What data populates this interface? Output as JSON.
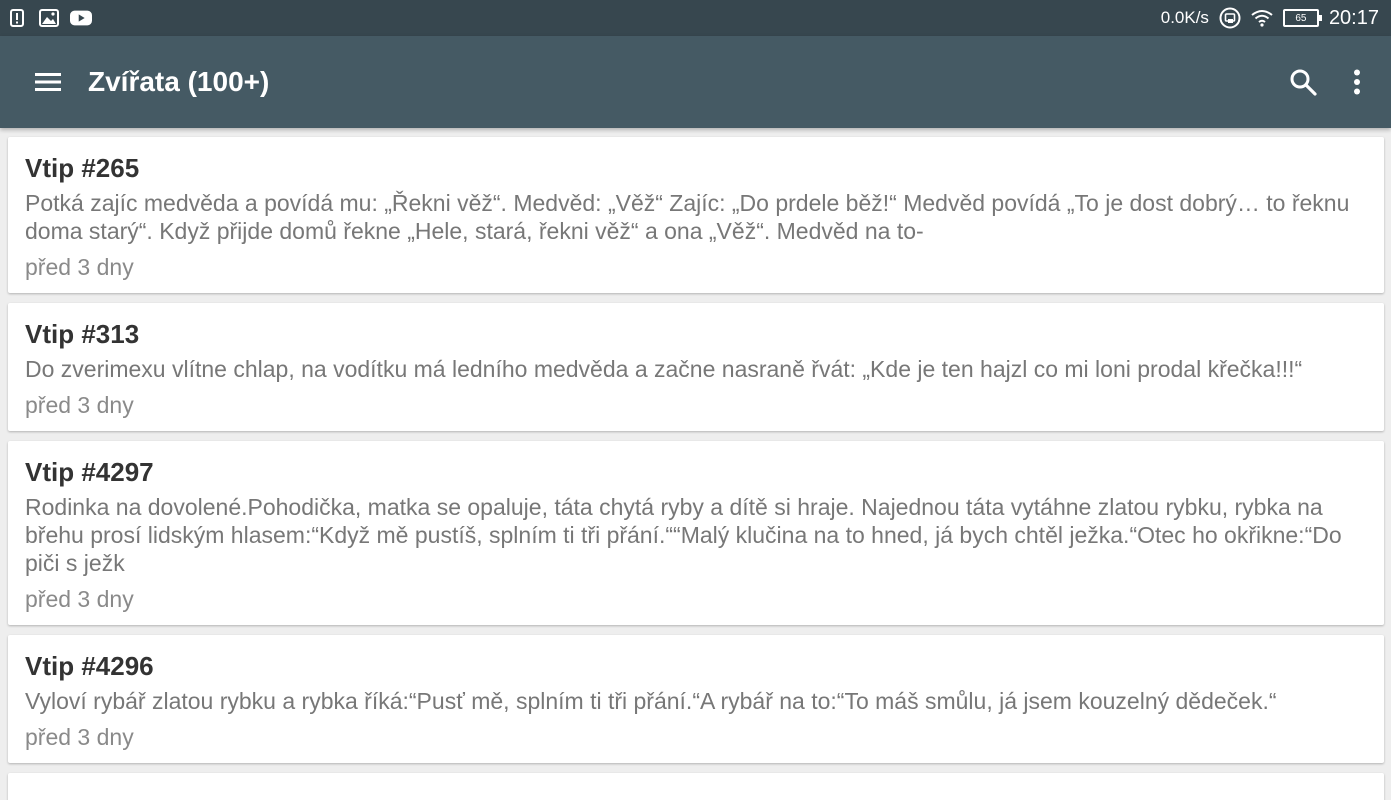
{
  "status_bar": {
    "left_icons": [
      "alert-icon",
      "image-icon",
      "youtube-icon"
    ],
    "net_speed": "0.0K/s",
    "battery": "65",
    "time": "20:17"
  },
  "app_bar": {
    "title": "Zvířata (100+)",
    "menu_icon": "hamburger-menu-icon",
    "search_icon": "search-icon",
    "overflow_icon": "more-vert-icon"
  },
  "jokes": [
    {
      "title": "Vtip #265",
      "text": "Potká zajíc medvěda a povídá mu: „Řekni věž“. Medvěd: „Věž“ Zajíc: „Do prdele běž!“ Medvěd povídá „To je dost dobrý… to řeknu doma starý“. Když přijde domů řekne „Hele, stará, řekni věž“ a ona „Věž“. Medvěd na to-",
      "date": "před 3 dny"
    },
    {
      "title": "Vtip #313",
      "text": "Do zverimexu vlítne chlap, na vodítku má ledního medvěda a začne nasraně řvát: „Kde je ten hajzl co mi loni prodal křečka!!!“",
      "date": "před 3 dny"
    },
    {
      "title": "Vtip #4297",
      "text": "Rodinka na dovolené.Pohodička, matka se opaluje, táta chytá ryby a dítě si hraje. Najednou táta vytáhne zlatou rybku, rybka na břehu prosí lidským hlasem:“Když mě pustíš, splním ti tři přání.““Malý klučina na to hned, já bych chtěl ježka.“Otec ho okřikne:“Do piči s ježk",
      "date": "před 3 dny"
    },
    {
      "title": "Vtip #4296",
      "text": "Vyloví rybář zlatou rybku a rybka říká:“Pusť mě, splním ti tři přání.“A rybář na to:“To máš smůlu, já jsem kouzelný dědeček.“",
      "date": "před 3 dny"
    }
  ]
}
